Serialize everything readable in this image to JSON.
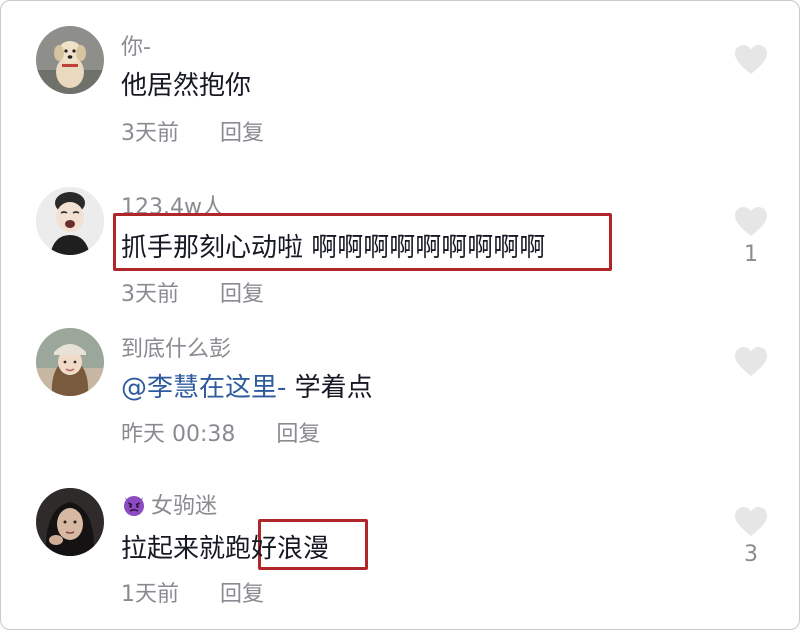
{
  "comments": [
    {
      "username": "你-",
      "text": "他居然抱你",
      "time": "3天前",
      "reply_label": "回复",
      "like_count": ""
    },
    {
      "username": "123.4w人",
      "text": "抓手那刻心动啦 啊啊啊啊啊啊啊啊啊",
      "time": "3天前",
      "reply_label": "回复",
      "like_count": "1"
    },
    {
      "username": "到底什么彭",
      "mention": "@李慧在这里-",
      "text": " 学着点",
      "time": "昨天 00:38",
      "reply_label": "回复",
      "like_count": ""
    },
    {
      "username": "女驹迷",
      "username_icon": "purple-devil-emoji-icon",
      "text_before": "拉起来就跑",
      "text_highlight": "好浪漫",
      "time": "1天前",
      "reply_label": "回复",
      "like_count": "3"
    }
  ],
  "colors": {
    "primary_text": "#161823",
    "secondary_text": "#8a8b91",
    "mention": "#2e5b9d",
    "highlight_box": "#b1262a",
    "heart": "#e6e6e6"
  }
}
